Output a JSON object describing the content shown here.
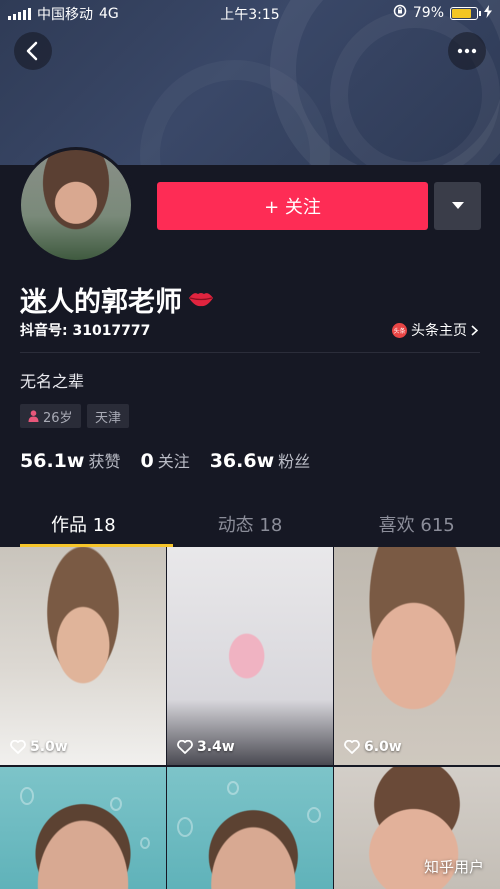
{
  "status_bar": {
    "carrier": "中国移动",
    "network": "4G",
    "time": "上午3:15",
    "battery": "79%",
    "battery_level": 0.79
  },
  "profile": {
    "follow_label": "+ 关注",
    "name": "迷人的郭老师",
    "douyin_id": "抖音号: 31017777",
    "toutiao_badge": "头条",
    "toutiao_link": "头条主页",
    "bio": "无名之辈",
    "tags": {
      "age": "26岁",
      "city": "天津"
    }
  },
  "stats": [
    {
      "value": "56.1w",
      "label": "获赞"
    },
    {
      "value": "0",
      "label": "关注"
    },
    {
      "value": "36.6w",
      "label": "粉丝"
    }
  ],
  "tabs": [
    {
      "label": "作品 18",
      "active": true
    },
    {
      "label": "动态 18",
      "active": false
    },
    {
      "label": "喜欢 615",
      "active": false
    }
  ],
  "videos": [
    {
      "likes": "5.0w"
    },
    {
      "likes": "3.4w"
    },
    {
      "likes": "6.0w"
    },
    {
      "likes": ""
    },
    {
      "likes": ""
    },
    {
      "likes": ""
    }
  ],
  "watermark": "知乎用户",
  "colors": {
    "accent": "#fe2c55",
    "tab_indicator": "#f7c52a",
    "background": "#161824"
  }
}
